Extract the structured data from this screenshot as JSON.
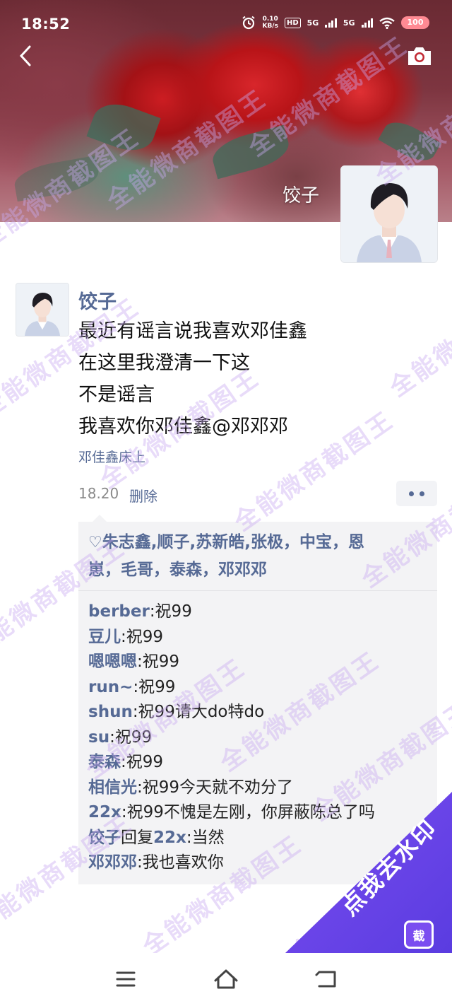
{
  "status_bar": {
    "time": "18:52",
    "net_speed_value": "0.10",
    "net_speed_unit": "KB/s",
    "hd_label": "HD",
    "sim1_label": "5G",
    "sim2_label": "5G",
    "battery": "100"
  },
  "cover": {
    "name": "饺子"
  },
  "post": {
    "username": "饺子",
    "lines": [
      "最近有谣言说我喜欢邓佳鑫",
      "在这里我澄清一下这",
      "不是谣言",
      "我喜欢你邓佳鑫@邓邓邓"
    ],
    "location": "邓佳鑫床上",
    "time": "18.20",
    "delete_label": "删除"
  },
  "likes": {
    "line1": "朱志鑫,顺子,苏新皓,张极，中宝，恩",
    "line2": "崽，毛哥，泰森，邓邓邓"
  },
  "comments": [
    {
      "name": "berber",
      "text": ":祝99"
    },
    {
      "name": "豆儿",
      "text": ":祝99"
    },
    {
      "name": "嗯嗯嗯",
      "text": ":祝99"
    },
    {
      "name": "run~",
      "text": ":祝99"
    },
    {
      "name": "shun",
      "text": ":祝99请大do特do"
    },
    {
      "name": "su",
      "text": ":祝99"
    },
    {
      "name": "泰森",
      "text": ":祝99"
    },
    {
      "name": "相信光",
      "text": ":祝99今天就不劝分了"
    },
    {
      "name": "22x",
      "text": ":祝99不愧是左刚，你屏蔽陈总了吗"
    },
    {
      "name": "饺子",
      "reply_word": "回复",
      "reply_to": "22x",
      "text": ":当然"
    },
    {
      "name": "邓邓邓",
      "text": ":我也喜欢你"
    }
  ],
  "watermark": "全能微商截图王",
  "promo": {
    "label": "点我去水印",
    "icon_char": "截"
  },
  "icons": {
    "back": "chevron-left-icon",
    "camera": "camera-icon",
    "heart": "heart-outline-icon",
    "nav": [
      "menu-icon",
      "home-icon",
      "back-icon"
    ]
  },
  "colors": {
    "link": "#566a95",
    "promo": "#6a45ea",
    "battery": "#ff8a93"
  }
}
